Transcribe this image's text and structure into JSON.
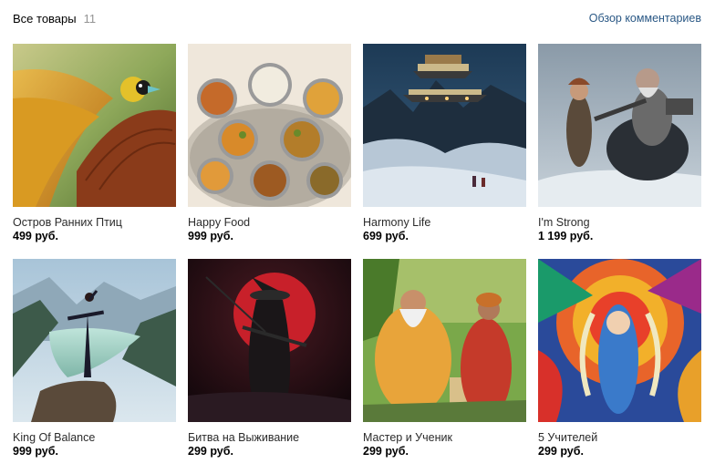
{
  "header": {
    "title": "Все товары",
    "count": "11",
    "reviews_link": "Обзор комментариев"
  },
  "items": [
    {
      "title": "Остров Ранних Птиц",
      "price": "499 руб."
    },
    {
      "title": "Happy Food",
      "price": "999 руб."
    },
    {
      "title": "Harmony Life",
      "price": "699 руб."
    },
    {
      "title": "I'm Strong",
      "price": "1 199 руб."
    },
    {
      "title": "King Of Balance",
      "price": "999 руб."
    },
    {
      "title": "Битва на Выживание",
      "price": "299 руб."
    },
    {
      "title": "Мастер и Ученик",
      "price": "299 руб."
    },
    {
      "title": "5 Учителей",
      "price": "299 руб."
    }
  ]
}
